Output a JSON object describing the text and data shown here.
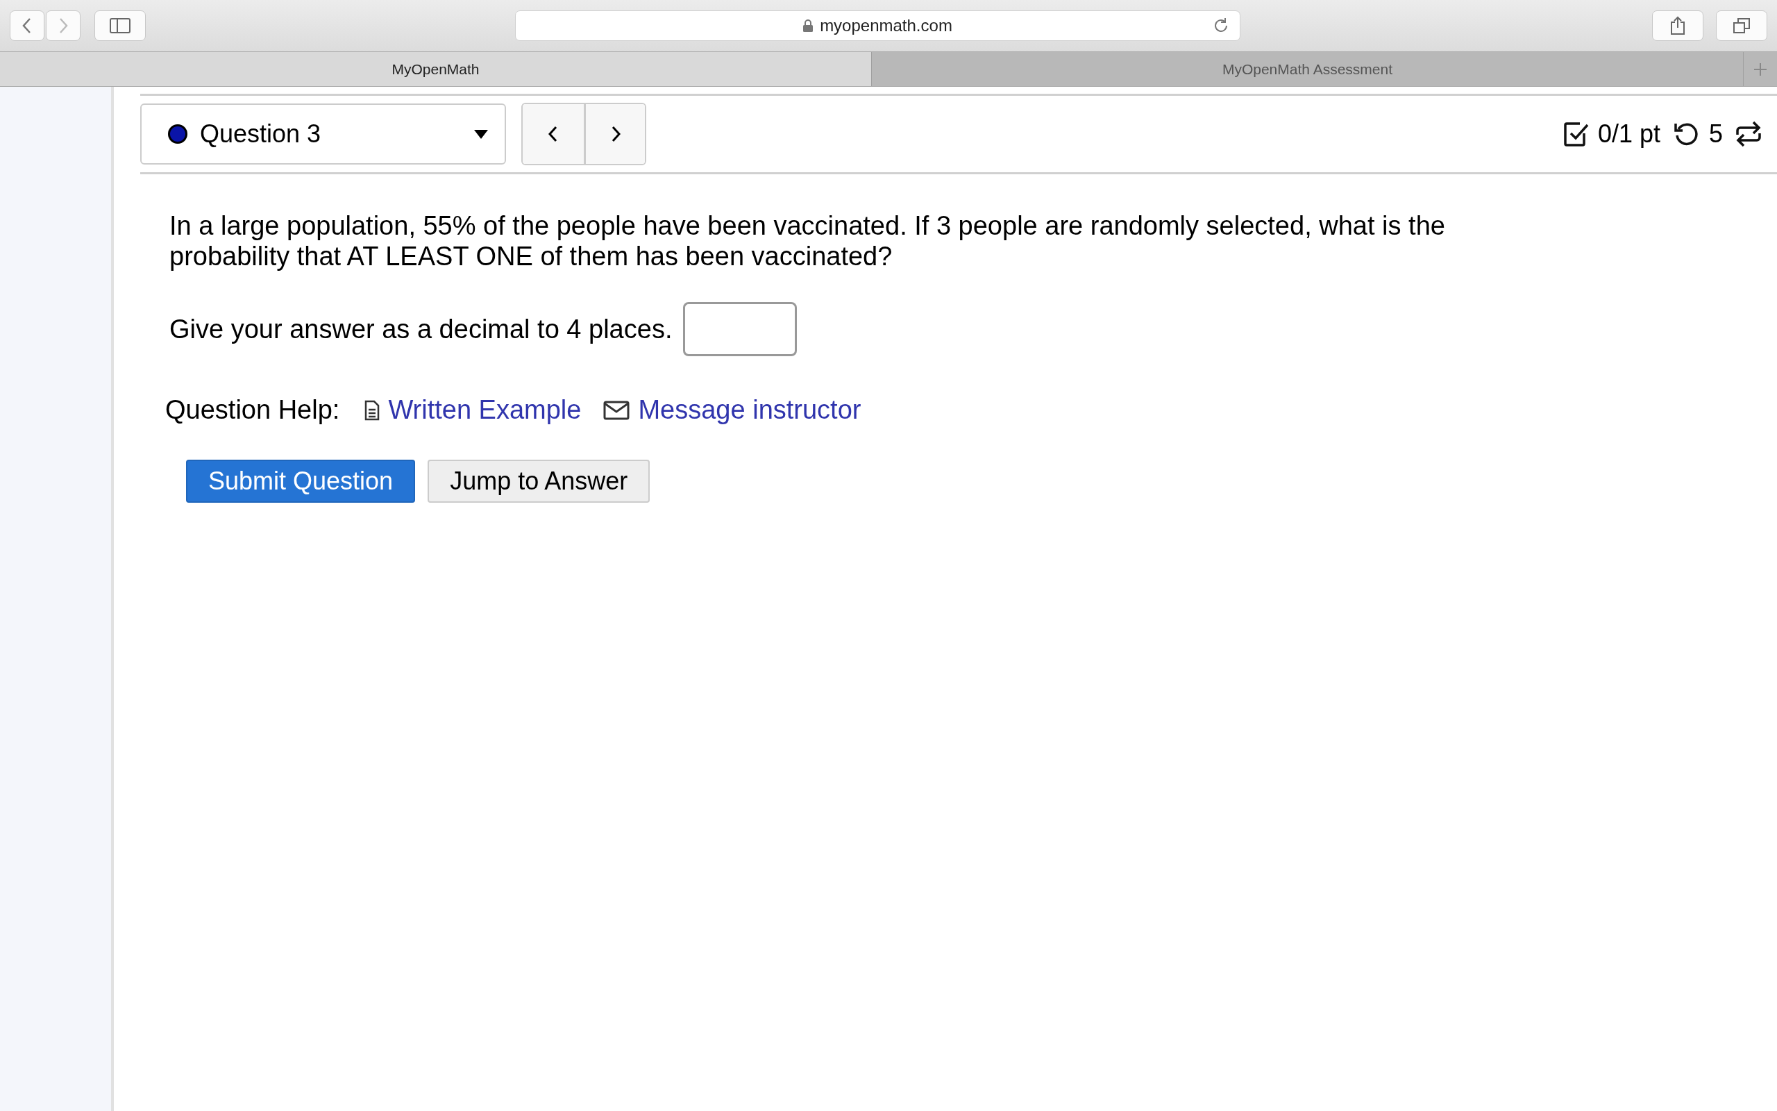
{
  "browser": {
    "url": "myopenmath.com",
    "tabs": [
      {
        "label": "MyOpenMath",
        "selected": true
      },
      {
        "label": "MyOpenMath Assessment",
        "selected": false
      }
    ]
  },
  "question_nav": {
    "label": "Question 3",
    "color": "#0a14a8"
  },
  "score": {
    "points": "0/1 pt",
    "retries": "5"
  },
  "question": {
    "text": "In a large population, 55% of the people have been vaccinated. If 3 people are randomly selected, what is the probability that AT LEAST ONE of them has been vaccinated?",
    "prompt": "Give your answer as a decimal to 4 places."
  },
  "help": {
    "label": "Question Help:",
    "links": [
      {
        "kind": "document",
        "label": "Written Example"
      },
      {
        "kind": "mail",
        "label": "Message instructor"
      }
    ]
  },
  "buttons": [
    {
      "label": "Submit Question",
      "kind": "primary"
    },
    {
      "label": "Jump to Answer",
      "kind": "secondary"
    }
  ]
}
